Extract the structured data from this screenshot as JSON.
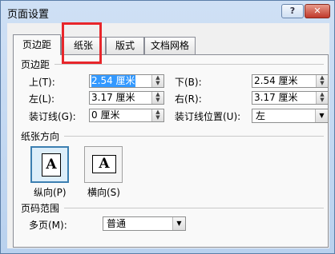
{
  "window": {
    "title": "页面设置",
    "help_label": "?",
    "close_label": "✕"
  },
  "tabs": [
    {
      "label": "页边距",
      "active": true
    },
    {
      "label": "纸张"
    },
    {
      "label": "版式"
    },
    {
      "label": "文档网格"
    }
  ],
  "margins": {
    "group_label": "页边距",
    "top": {
      "label": "上(T):",
      "value": "2.54 厘米"
    },
    "bottom": {
      "label": "下(B):",
      "value": "2.54 厘米"
    },
    "left": {
      "label": "左(L):",
      "value": "3.17 厘米"
    },
    "right": {
      "label": "右(R):",
      "value": "3.17 厘米"
    },
    "gutter": {
      "label": "装订线(G):",
      "value": "0 厘米"
    },
    "gutter_position": {
      "label": "装订线位置(U):",
      "value": "左"
    }
  },
  "orientation": {
    "group_label": "纸张方向",
    "portrait": {
      "label": "纵向(P)",
      "glyph": "A",
      "selected": true
    },
    "landscape": {
      "label": "横向(S)",
      "glyph": "A"
    }
  },
  "pages": {
    "group_label": "页码范围",
    "multiple_label": "多页(M):",
    "value": "普通"
  },
  "highlight_color": "#e8262b",
  "accent_color": "#3399ff"
}
